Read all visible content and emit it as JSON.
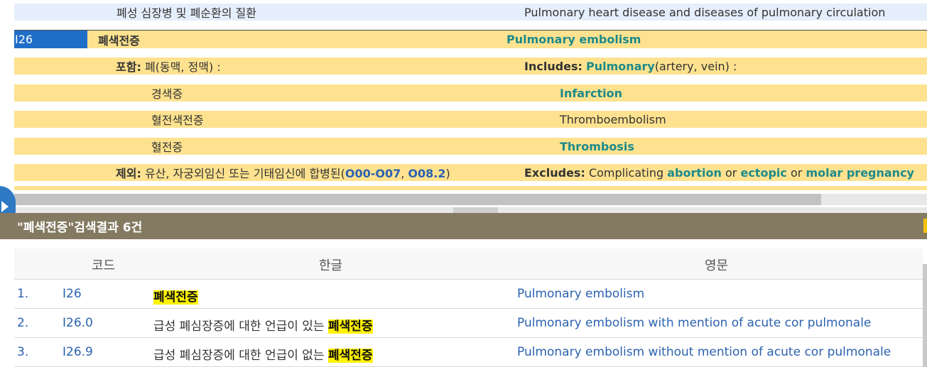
{
  "section": {
    "row0": {
      "ko": "폐성 심장병 및 폐순환의 질환",
      "en": "Pulmonary heart disease and diseases of pulmonary circulation"
    },
    "header": {
      "code": "I26",
      "ko": "폐색전증",
      "en": "Pulmonary embolism"
    },
    "includes": {
      "ko_label": "포함:",
      "ko_text": "폐(동맥, 정맥) :",
      "en_label": "Includes:",
      "en_link": "Pulmonary",
      "en_text": "(artery, vein) :"
    },
    "items": [
      {
        "ko": "경색증",
        "en": "Infarction",
        "en_link": true
      },
      {
        "ko": "혈전색전증",
        "en": "Thromboembolism",
        "en_link": false
      },
      {
        "ko": "혈전증",
        "en": "Thrombosis",
        "en_link": true
      }
    ],
    "excludes": {
      "ko_label": "제외:",
      "ko_text": "유산, 자궁외임신 또는 기태임신에 합병된(",
      "ko_link1": "O00-O07",
      "ko_sep": ", ",
      "ko_link2": "O08.2",
      "ko_end": ")",
      "en_label": "Excludes:",
      "en_text1": "Complicating",
      "en_link1": "abortion",
      "en_or1": "or",
      "en_link2": "ectopic",
      "en_or2": "or",
      "en_link3": "molar pregnancy"
    }
  },
  "results": {
    "title": "\"폐색전증\"검색결과 6건",
    "columns": {
      "code": "코드",
      "ko": "한글",
      "en": "영문"
    },
    "rows": [
      {
        "num": "1.",
        "code": "I26",
        "ko_pre": "",
        "ko_hl": "폐색전증",
        "en": "Pulmonary embolism"
      },
      {
        "num": "2.",
        "code": "I26.0",
        "ko_pre": "급성 폐심장증에 대한 언급이 있는 ",
        "ko_hl": "폐색전증",
        "en": "Pulmonary embolism with mention of acute cor pulmonale"
      },
      {
        "num": "3.",
        "code": "I26.9",
        "ko_pre": "급성 폐심장증에 대한 언급이 없는 ",
        "ko_hl": "폐색전증",
        "en": "Pulmonary embolism without mention of acute cor pulmonale"
      }
    ]
  },
  "colors": {
    "header_blue": "#1e6ec8",
    "row_yellow": "#fee28f",
    "row_blue": "#e5eefb",
    "teal": "#1c8a8a",
    "link_blue": "#2c62b0",
    "bar_brown": "#847a62",
    "highlight": "#fff200"
  }
}
